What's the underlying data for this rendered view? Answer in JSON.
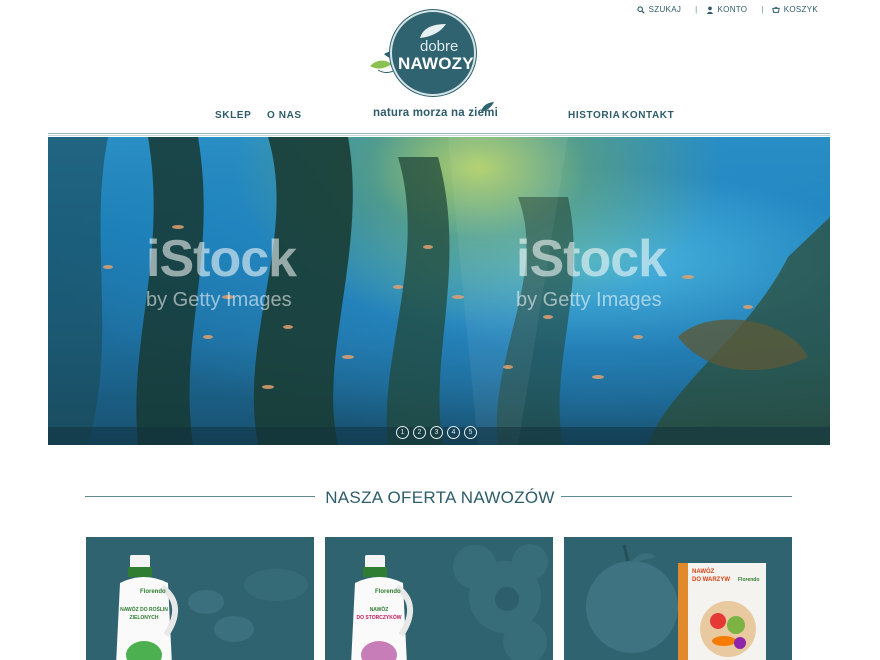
{
  "topbar": {
    "search": "SZUKAJ",
    "account": "KONTO",
    "cart": "KOSZYK"
  },
  "logo": {
    "line1": "dobre",
    "line2": "NAWOZY"
  },
  "nav": {
    "shop": "SKLEP",
    "about": "O NAS",
    "tagline": "natura morza na ziemi",
    "history": "HISTORIA",
    "contact": "KONTAKT"
  },
  "hero": {
    "watermark_main": "iStock",
    "watermark_sub": "by Getty Images",
    "slides": [
      "1",
      "2",
      "3",
      "4",
      "5"
    ]
  },
  "offer": {
    "title": "NASZA OFERTA NAWOZÓW",
    "products": [
      {
        "brand": "Florendo",
        "label_top": "NAWÓZ DO ROŚLIN",
        "label_bottom": "ZIELONYCH"
      },
      {
        "brand": "Florendo",
        "label_top": "NAWÓZ",
        "label_bottom": "DO STORCZYKÓW"
      },
      {
        "brand": "Florendo",
        "label_top": "NAWÓZ",
        "label_bottom": "DO WARZYW"
      }
    ]
  },
  "colors": {
    "brand": "#2f6370",
    "text": "#2e5c6a",
    "accent_green": "#7cb342"
  }
}
